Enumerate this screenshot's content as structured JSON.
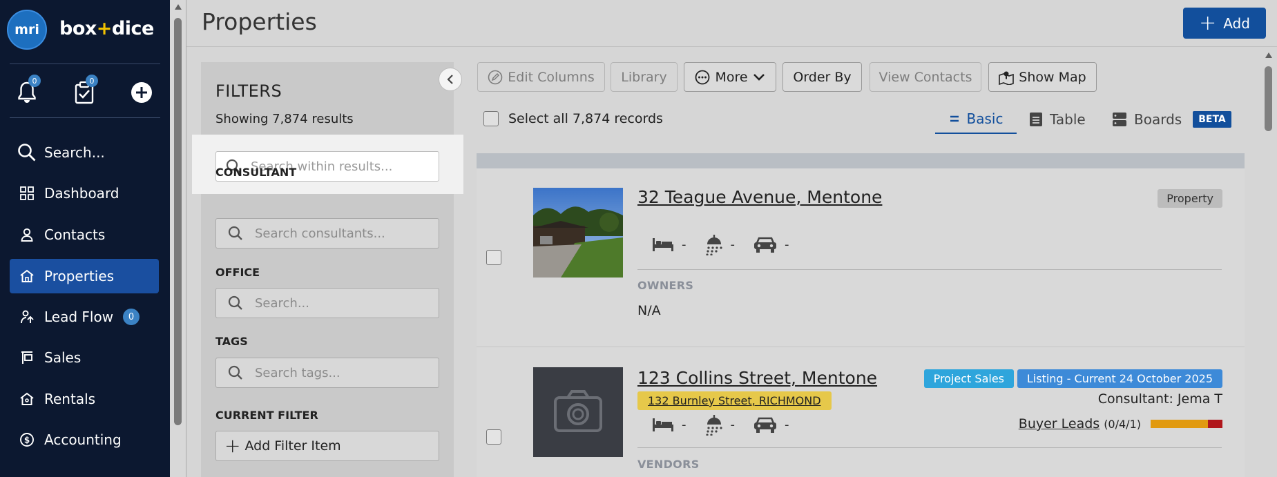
{
  "sidebar": {
    "logo_mark": "mri",
    "logo_text_a": "box",
    "logo_text_plus": "+",
    "logo_text_b": "dice",
    "notifications_count": "0",
    "tasks_count": "0",
    "items": [
      {
        "label": "Search..."
      },
      {
        "label": "Dashboard"
      },
      {
        "label": "Contacts"
      },
      {
        "label": "Properties"
      },
      {
        "label": "Lead Flow",
        "badge": "0"
      },
      {
        "label": "Sales"
      },
      {
        "label": "Rentals"
      },
      {
        "label": "Accounting"
      }
    ]
  },
  "header": {
    "title": "Properties",
    "add_label": "Add"
  },
  "filters": {
    "title": "FILTERS",
    "count_text": "Showing 7,874 results",
    "search_placeholder": "Search within results...",
    "consultant_label": "CONSULTANT",
    "consultant_placeholder": "Search consultants...",
    "office_label": "OFFICE",
    "office_placeholder": "Search...",
    "tags_label": "TAGS",
    "tags_placeholder": "Search tags...",
    "current_filter_label": "CURRENT FILTER",
    "add_filter_label": "Add Filter Item"
  },
  "toolbar": {
    "edit_columns": "Edit Columns",
    "library": "Library",
    "more": "More",
    "order_by": "Order By",
    "view_contacts": "View Contacts",
    "show_map": "Show Map",
    "select_all": "Select all 7,874 records"
  },
  "views": {
    "basic": "Basic",
    "table": "Table",
    "boards": "Boards",
    "beta": "BETA"
  },
  "listings": [
    {
      "address": "32 Teague Avenue, Mentone",
      "tag": "Property",
      "beds": "-",
      "baths": "-",
      "cars": "-",
      "owners_label": "OWNERS",
      "owners_value": "N/A"
    },
    {
      "address": "123 Collins Street, Mentone",
      "linked_address": "132 Burnley Street, RICHMOND",
      "tag_project": "Project Sales",
      "tag_listing": "Listing - Current 24 October 2025",
      "consultant": "Consultant: Jema T",
      "buyer_leads": "Buyer Leads",
      "buyer_leads_count": "(0/4/1)",
      "beds": "-",
      "baths": "-",
      "cars": "-",
      "vendors_label": "VENDORS"
    }
  ],
  "colors": {
    "sidebar_bg": "#0c1830",
    "brand_blue": "#124f9c",
    "tag_project": "#2ea5dc",
    "tag_listing": "#3d8ad8",
    "bar_orange": "#e19a10",
    "bar_red": "#b0161b"
  }
}
